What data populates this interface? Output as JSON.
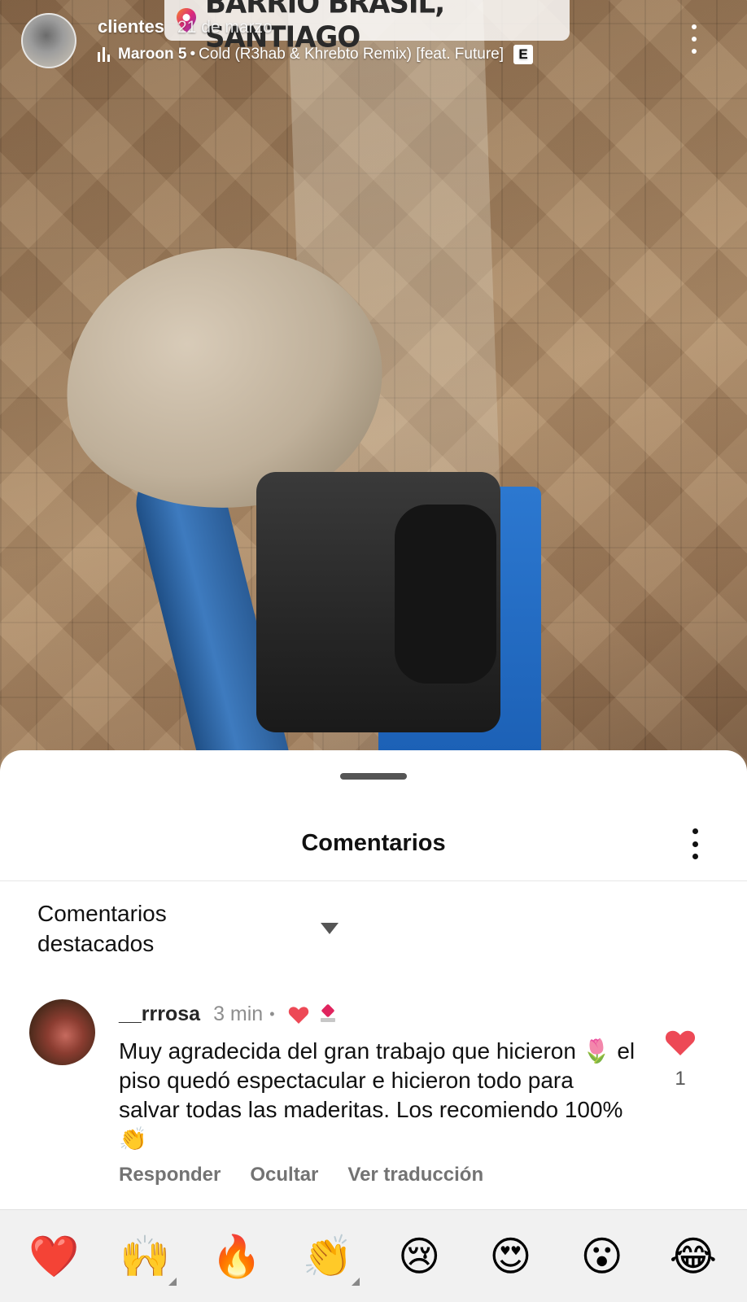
{
  "story": {
    "username": "clientes",
    "date": "21 de marzo",
    "location": "BARRIO BRASIL, SANTIAGO",
    "music": {
      "artist": "Maroon 5",
      "separator": "•",
      "track": "Cold (R3hab & Khrebto Remix) [feat. Future]",
      "explicit": "E"
    }
  },
  "sheet": {
    "title": "Comentarios",
    "filter_label": "Comentarios destacados"
  },
  "comment": {
    "user": "__rrrosa",
    "time": "3 min",
    "dot": "•",
    "text": "Muy agradecida del gran trabajo que hicieron 🌷 el piso quedó espectacular e hicieron todo para salvar todas las maderitas. Los recomiendo 100% 👏",
    "likes": "1",
    "actions": {
      "reply": "Responder",
      "hide": "Ocultar",
      "translate": "Ver traducción"
    }
  },
  "reactions": [
    {
      "name": "heart",
      "glyph": "❤️"
    },
    {
      "name": "raising-hands",
      "glyph": "🙌"
    },
    {
      "name": "fire",
      "glyph": "🔥"
    },
    {
      "name": "clapping-hands",
      "glyph": "👏"
    },
    {
      "name": "crying-face",
      "glyph": "😢"
    },
    {
      "name": "heart-eyes",
      "glyph": "😍"
    },
    {
      "name": "surprised-face",
      "glyph": "😮"
    },
    {
      "name": "laughing-face",
      "glyph": "😂"
    }
  ],
  "colors": {
    "heart": "#ed4956",
    "text_primary": "#111111",
    "text_secondary": "#8e8e8e"
  }
}
